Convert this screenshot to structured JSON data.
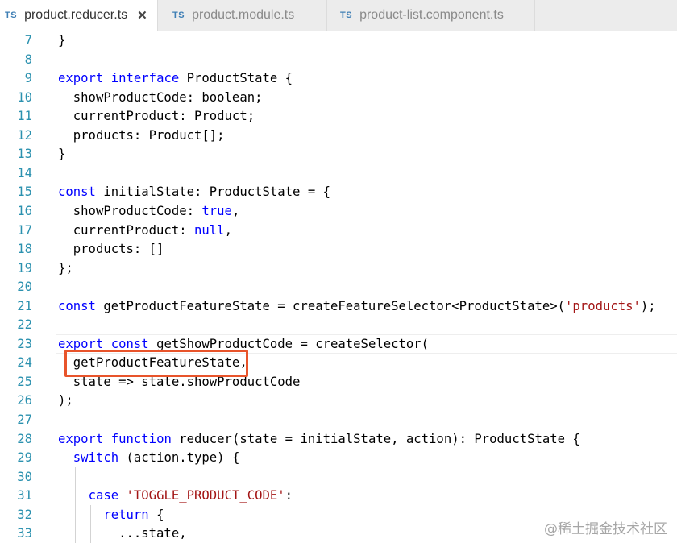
{
  "tabs": [
    {
      "icon": "TS",
      "label": "product.reducer.ts",
      "close": "✕",
      "active": true
    },
    {
      "icon": "TS",
      "label": "product.module.ts",
      "active": false
    },
    {
      "icon": "TS",
      "label": "product-list.component.ts",
      "active": false
    }
  ],
  "lines": [
    {
      "n": "7",
      "tokens": [
        {
          "t": "}",
          "c": ""
        }
      ]
    },
    {
      "n": "8",
      "tokens": []
    },
    {
      "n": "9",
      "tokens": [
        {
          "t": "export",
          "c": "kw"
        },
        {
          "t": " ",
          "c": ""
        },
        {
          "t": "interface",
          "c": "kw"
        },
        {
          "t": " ProductState {",
          "c": ""
        }
      ]
    },
    {
      "n": "10",
      "tokens": [
        {
          "t": "  showProductCode: boolean;",
          "c": ""
        }
      ]
    },
    {
      "n": "11",
      "tokens": [
        {
          "t": "  currentProduct: Product;",
          "c": ""
        }
      ]
    },
    {
      "n": "12",
      "tokens": [
        {
          "t": "  products: Product[];",
          "c": ""
        }
      ]
    },
    {
      "n": "13",
      "tokens": [
        {
          "t": "}",
          "c": ""
        }
      ]
    },
    {
      "n": "14",
      "tokens": []
    },
    {
      "n": "15",
      "tokens": [
        {
          "t": "const",
          "c": "kw"
        },
        {
          "t": " initialState: ProductState = {",
          "c": ""
        }
      ]
    },
    {
      "n": "16",
      "tokens": [
        {
          "t": "  showProductCode: ",
          "c": ""
        },
        {
          "t": "true",
          "c": "kw"
        },
        {
          "t": ",",
          "c": ""
        }
      ]
    },
    {
      "n": "17",
      "tokens": [
        {
          "t": "  currentProduct: ",
          "c": ""
        },
        {
          "t": "null",
          "c": "kw"
        },
        {
          "t": ",",
          "c": ""
        }
      ]
    },
    {
      "n": "18",
      "tokens": [
        {
          "t": "  products: []",
          "c": ""
        }
      ]
    },
    {
      "n": "19",
      "tokens": [
        {
          "t": "};",
          "c": ""
        }
      ]
    },
    {
      "n": "20",
      "tokens": []
    },
    {
      "n": "21",
      "tokens": [
        {
          "t": "const",
          "c": "kw"
        },
        {
          "t": " getProductFeatureState = createFeatureSelector<ProductState>(",
          "c": ""
        },
        {
          "t": "'products'",
          "c": "str"
        },
        {
          "t": ");",
          "c": ""
        }
      ]
    },
    {
      "n": "22",
      "tokens": []
    },
    {
      "n": "23",
      "tokens": [
        {
          "t": "export",
          "c": "kw"
        },
        {
          "t": " ",
          "c": ""
        },
        {
          "t": "const",
          "c": "kw"
        },
        {
          "t": " getShowProductCode = createSelector(",
          "c": ""
        }
      ]
    },
    {
      "n": "24",
      "tokens": [
        {
          "t": "  getProductFeatureState,",
          "c": ""
        }
      ]
    },
    {
      "n": "25",
      "tokens": [
        {
          "t": "  state => state.showProductCode",
          "c": ""
        }
      ]
    },
    {
      "n": "26",
      "tokens": [
        {
          "t": ");",
          "c": ""
        }
      ]
    },
    {
      "n": "27",
      "tokens": []
    },
    {
      "n": "28",
      "tokens": [
        {
          "t": "export",
          "c": "kw"
        },
        {
          "t": " ",
          "c": ""
        },
        {
          "t": "function",
          "c": "kw"
        },
        {
          "t": " reducer(state = initialState, action): ProductState {",
          "c": ""
        }
      ]
    },
    {
      "n": "29",
      "tokens": [
        {
          "t": "  ",
          "c": ""
        },
        {
          "t": "switch",
          "c": "kw"
        },
        {
          "t": " (action.type) {",
          "c": ""
        }
      ]
    },
    {
      "n": "30",
      "tokens": []
    },
    {
      "n": "31",
      "tokens": [
        {
          "t": "    ",
          "c": ""
        },
        {
          "t": "case",
          "c": "kw"
        },
        {
          "t": " ",
          "c": ""
        },
        {
          "t": "'TOGGLE_PRODUCT_CODE'",
          "c": "str"
        },
        {
          "t": ":",
          "c": ""
        }
      ]
    },
    {
      "n": "32",
      "tokens": [
        {
          "t": "      ",
          "c": ""
        },
        {
          "t": "return",
          "c": "kw"
        },
        {
          "t": " {",
          "c": ""
        }
      ]
    },
    {
      "n": "33",
      "tokens": [
        {
          "t": "        ...state,",
          "c": ""
        }
      ]
    }
  ],
  "watermark": "@稀土掘金技术社区",
  "colors": {
    "keyword": "#0000ff",
    "string": "#a31515",
    "line_number": "#2b91af",
    "highlight_box": "#e8542b"
  }
}
